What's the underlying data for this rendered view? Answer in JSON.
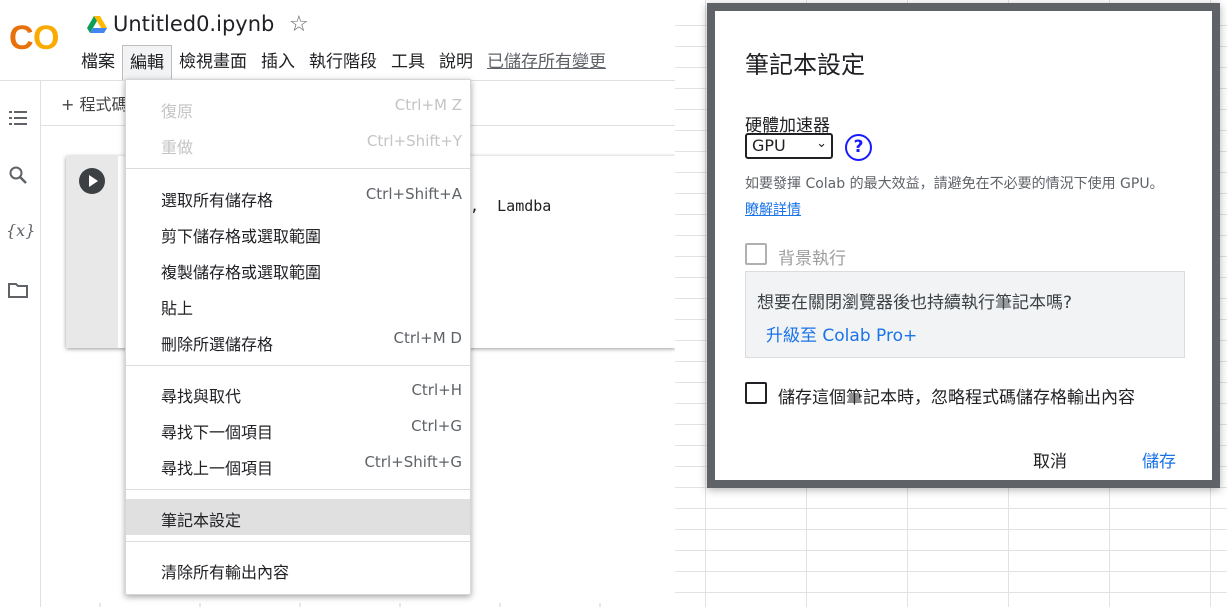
{
  "app": {
    "notebook_title": "Untitled0.ipynb",
    "logo_text": "CO"
  },
  "menubar": {
    "items": [
      "檔案",
      "編輯",
      "檢視畫面",
      "插入",
      "執行階段",
      "工具",
      "說明"
    ],
    "saved_status": "已儲存所有變更",
    "active_index": 1
  },
  "toolbar": {
    "add_code_label": "+ 程式碼"
  },
  "cell": {
    "visible_code": "se,  Lamdba"
  },
  "leftbar": {
    "icons": [
      "list-icon",
      "search-icon",
      "variables-icon",
      "folder-icon"
    ],
    "variables_label": "{x}"
  },
  "edit_menu": {
    "groups": [
      [
        {
          "label": "復原",
          "shortcut": "Ctrl+M Z",
          "disabled": true
        },
        {
          "label": "重做",
          "shortcut": "Ctrl+Shift+Y",
          "disabled": true
        }
      ],
      [
        {
          "label": "選取所有儲存格",
          "shortcut": "Ctrl+Shift+A"
        },
        {
          "label": "剪下儲存格或選取範圍",
          "shortcut": ""
        },
        {
          "label": "複製儲存格或選取範圍",
          "shortcut": ""
        },
        {
          "label": "貼上",
          "shortcut": ""
        },
        {
          "label": "刪除所選儲存格",
          "shortcut": "Ctrl+M D"
        }
      ],
      [
        {
          "label": "尋找與取代",
          "shortcut": "Ctrl+H"
        },
        {
          "label": "尋找下一個項目",
          "shortcut": "Ctrl+G"
        },
        {
          "label": "尋找上一個項目",
          "shortcut": "Ctrl+Shift+G"
        }
      ],
      [
        {
          "label": "筆記本設定",
          "shortcut": "",
          "highlighted": true
        }
      ],
      [
        {
          "label": "清除所有輸出內容",
          "shortcut": ""
        }
      ]
    ]
  },
  "dialog": {
    "title": "筆記本設定",
    "accelerator_label": "硬體加速器",
    "accelerator_value": "GPU",
    "help_symbol": "?",
    "hint": "如要發揮 Colab 的最大效益，請避免在不必要的情況下使用 GPU。",
    "learn_more": "瞭解詳情",
    "background_exec_label": "背景執行",
    "upsell_question": "想要在關閉瀏覽器後也持續執行筆記本嗎?",
    "upsell_link": "升級至 Colab Pro+",
    "omit_output_label": "儲存這個筆記本時，忽略程式碼儲存格輸出內容",
    "cancel_label": "取消",
    "save_label": "儲存"
  },
  "colors": {
    "accent": "#1a73e8",
    "logo_orange": "#f9ab00",
    "logo_dark_orange": "#e8710a"
  }
}
